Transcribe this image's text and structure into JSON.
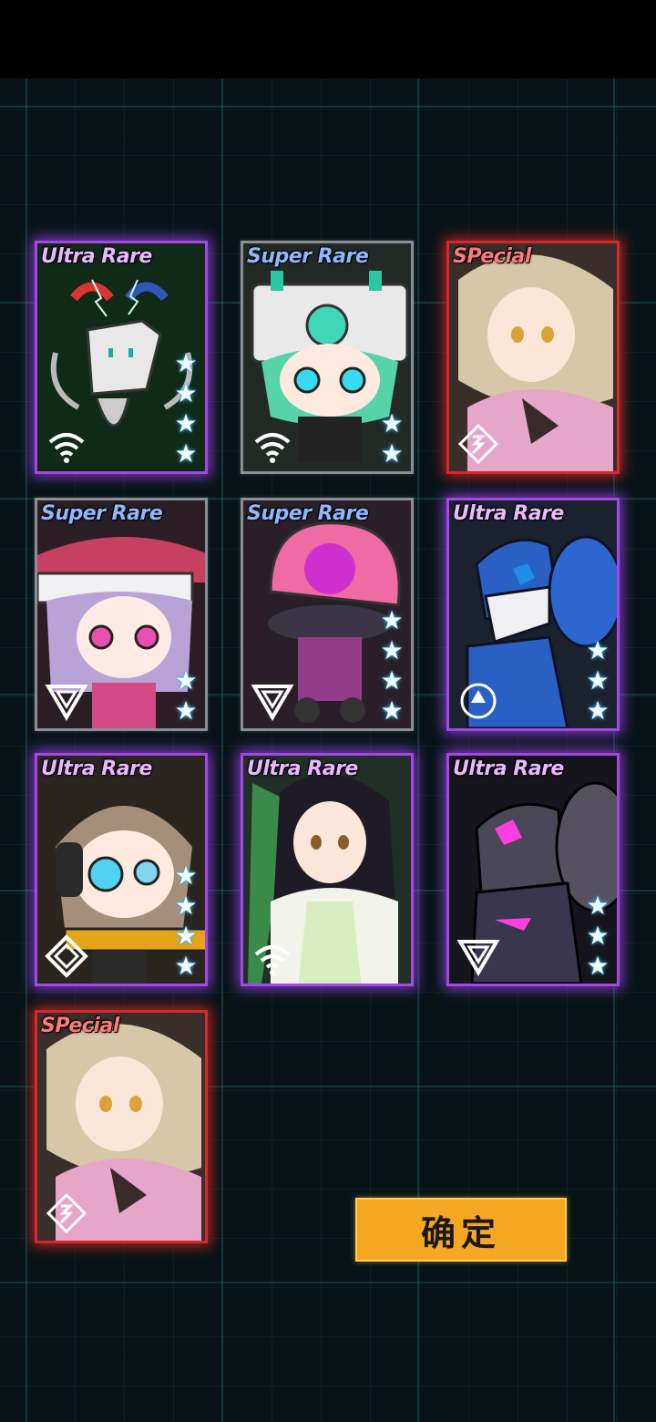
{
  "cards": [
    {
      "rarity": "Ultra Rare",
      "tier": "ur",
      "stars": 4,
      "class_icon": "wifi-class-icon"
    },
    {
      "rarity": "Super Rare",
      "tier": "sr",
      "stars": 2,
      "class_icon": "wifi-class-icon"
    },
    {
      "rarity": "SPecial",
      "tier": "sp",
      "stars": 0,
      "class_icon": "special-class-icon"
    },
    {
      "rarity": "Super Rare",
      "tier": "sr",
      "stars": 2,
      "class_icon": "triangle-class-icon"
    },
    {
      "rarity": "Super Rare",
      "tier": "sr",
      "stars": 4,
      "class_icon": "triangle-class-icon"
    },
    {
      "rarity": "Ultra Rare",
      "tier": "ur",
      "stars": 3,
      "class_icon": "circle-class-icon"
    },
    {
      "rarity": "Ultra Rare",
      "tier": "ur",
      "stars": 4,
      "class_icon": "diamond-class-icon"
    },
    {
      "rarity": "Ultra Rare",
      "tier": "ur",
      "stars": 0,
      "class_icon": "wifi-class-icon"
    },
    {
      "rarity": "Ultra Rare",
      "tier": "ur",
      "stars": 3,
      "class_icon": "triangle-class-icon"
    },
    {
      "rarity": "SPecial",
      "tier": "sp",
      "stars": 0,
      "class_icon": "special-class-icon"
    }
  ],
  "confirm_label": "确定",
  "colors": {
    "accent": "#f5a623",
    "ultra_rare": "#a348e0",
    "special": "#d22a2a",
    "super_rare": "#8a8f96"
  }
}
